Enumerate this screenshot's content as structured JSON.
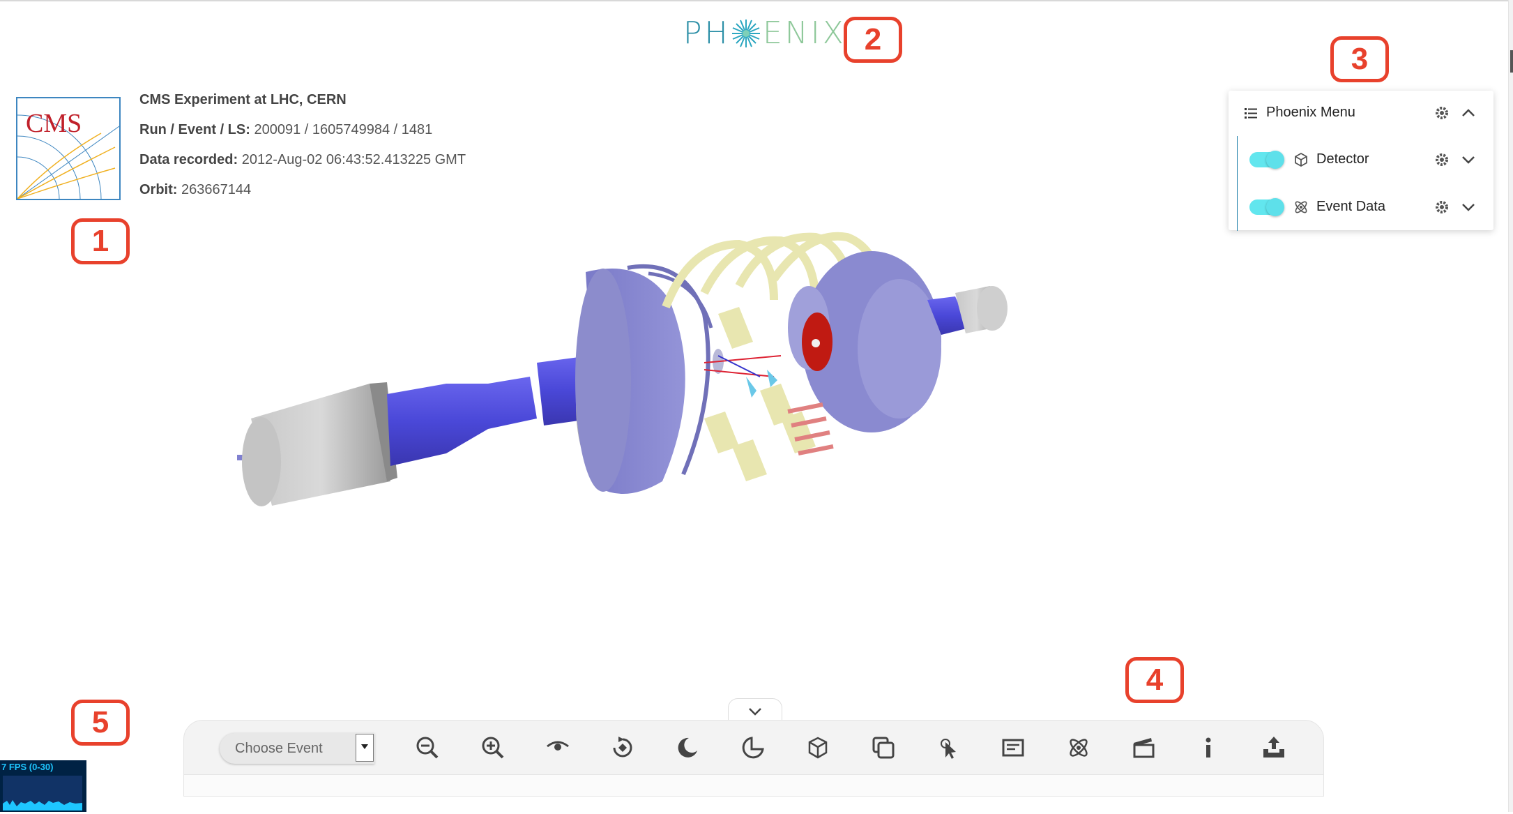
{
  "app": {
    "logo_text_left": "PH",
    "logo_text_right": "ENIX",
    "accent": "#62e6ee",
    "callout_color": "#e8412c"
  },
  "callouts": [
    "1",
    "2",
    "3",
    "4",
    "5"
  ],
  "experiment_info": {
    "logo_text": "CMS",
    "title": "CMS Experiment at LHC, CERN",
    "run_label": "Run / Event / LS:",
    "run_value": "200091 / 1605749984 / 1481",
    "recorded_label": "Data recorded:",
    "recorded_value": "2012-Aug-02 06:43:52.413225 GMT",
    "orbit_label": "Orbit:",
    "orbit_value": "263667144"
  },
  "menu": {
    "title": "Phoenix Menu",
    "items": [
      {
        "label": "Detector",
        "icon": "cube-icon",
        "toggle_on": true
      },
      {
        "label": "Event Data",
        "icon": "atom-icon",
        "toggle_on": true
      }
    ]
  },
  "toolbar": {
    "event_select_placeholder": "Choose Event",
    "buttons": [
      "zoom-out-icon",
      "zoom-in-icon",
      "eye-icon",
      "auto-rotate-icon",
      "dark-theme-icon",
      "clipping-icon",
      "object-selection-icon",
      "overlay-icon",
      "perform-pick-icon",
      "info-panel-icon",
      "collections-icon",
      "animate-icon",
      "info-icon",
      "export-icon"
    ]
  },
  "stats": {
    "fps_text": "7 FPS (0-30)"
  }
}
